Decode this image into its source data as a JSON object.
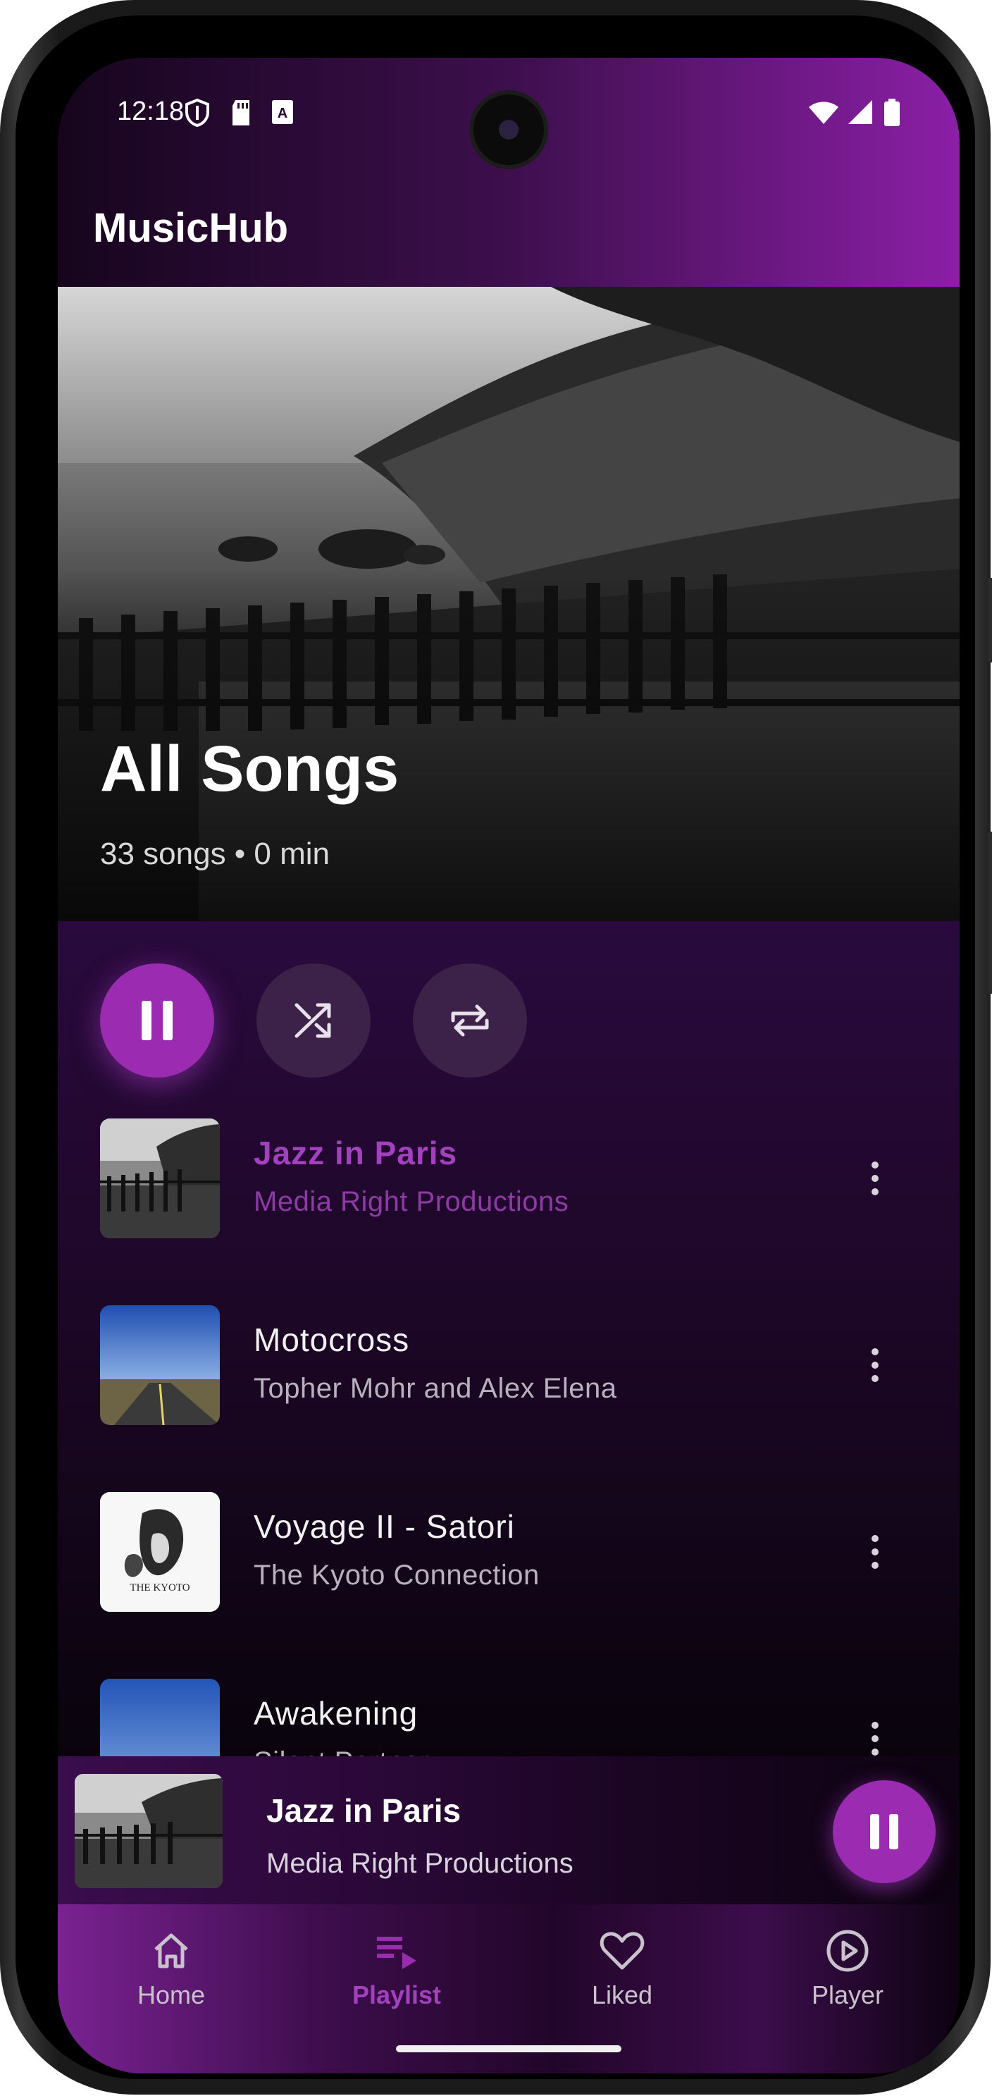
{
  "status_bar": {
    "time": "12:18"
  },
  "app": {
    "title": "MusicHub"
  },
  "playlist": {
    "title": "All Songs",
    "summary": "33 songs • 0 min"
  },
  "controls": {
    "pause": "pause",
    "shuffle": "shuffle",
    "repeat": "repeat"
  },
  "songs": [
    {
      "title": "Jazz in Paris",
      "artist": "Media Right Productions",
      "active": true
    },
    {
      "title": "Motocross",
      "artist": "Topher Mohr and Alex Elena",
      "active": false
    },
    {
      "title": "Voyage II - Satori",
      "artist": "The Kyoto Connection",
      "active": false
    },
    {
      "title": "Awakening",
      "artist": "Silent Partner",
      "active": false
    }
  ],
  "now_playing": {
    "title": "Jazz in Paris",
    "artist": "Media Right Productions"
  },
  "nav": [
    {
      "label": "Home",
      "icon": "home-icon",
      "active": false
    },
    {
      "label": "Playlist",
      "icon": "playlist-icon",
      "active": true
    },
    {
      "label": "Liked",
      "icon": "heart-icon",
      "active": false
    },
    {
      "label": "Player",
      "icon": "play-circle-icon",
      "active": false
    }
  ],
  "colors": {
    "accent": "#9b2bb0",
    "accent_text": "#a340bf",
    "header_gradient_end": "#8b1fa6"
  },
  "thumb_text": {
    "kyoto": "THE KYOTO"
  }
}
